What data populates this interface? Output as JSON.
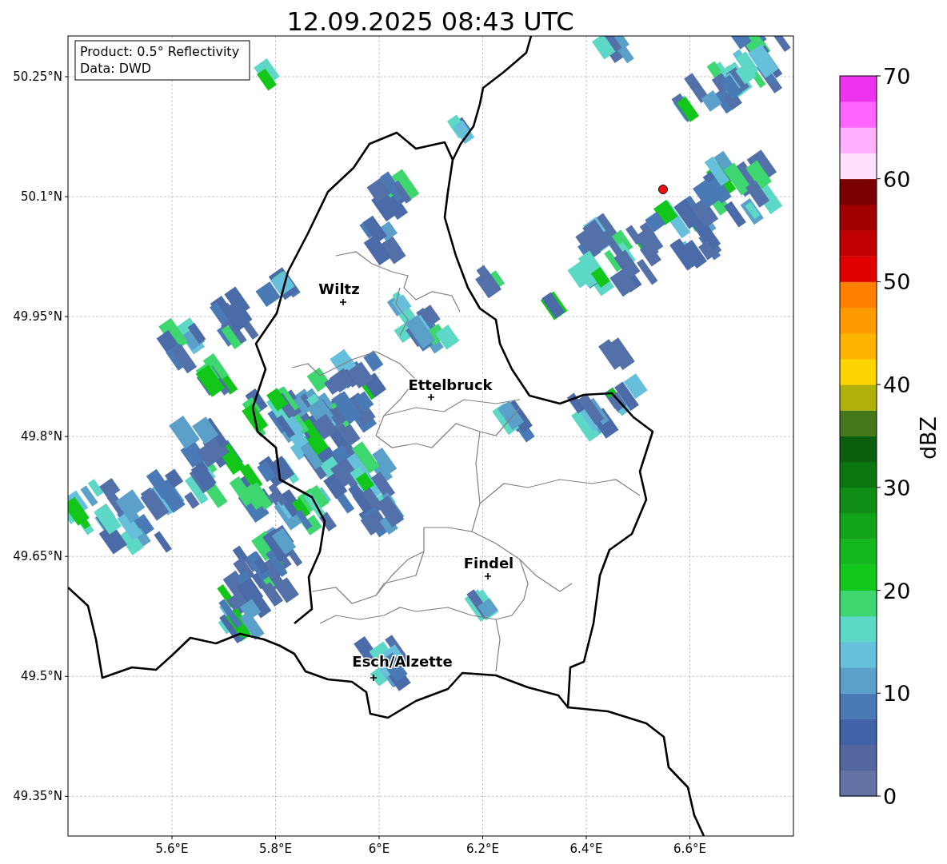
{
  "title": "12.09.2025 08:43 UTC",
  "legend": [
    "Product: 0.5° Reflectivity",
    "Data: DWD"
  ],
  "y_ticks": [
    "50.25°N",
    "50.1°N",
    "49.95°N",
    "49.8°N",
    "49.65°N",
    "49.5°N",
    "49.35°N"
  ],
  "x_ticks": [
    "5.6°E",
    "5.8°E",
    "6°E",
    "6.2°E",
    "6.4°E",
    "6.6°E"
  ],
  "places": [
    {
      "name": "Wiltz"
    },
    {
      "name": "Ettelbruck"
    },
    {
      "name": "Findel"
    },
    {
      "name": "Esch/Alzette"
    }
  ],
  "colorbar": {
    "label": "dBZ",
    "ticks": [
      "70",
      "60",
      "50",
      "40",
      "30",
      "20",
      "10",
      "0"
    ],
    "bins": [
      {
        "color": "#6272a4"
      },
      {
        "color": "#5466a0"
      },
      {
        "color": "#4262a8"
      },
      {
        "color": "#4a7ab5"
      },
      {
        "color": "#5aa0c8"
      },
      {
        "color": "#66c0dc"
      },
      {
        "color": "#5ed8c6"
      },
      {
        "color": "#3ed66e"
      },
      {
        "color": "#12c61a"
      },
      {
        "color": "#14b81c"
      },
      {
        "color": "#11a418"
      },
      {
        "color": "#0f8d14"
      },
      {
        "color": "#0b7510"
      },
      {
        "color": "#0b5e0e"
      },
      {
        "color": "#44761a"
      },
      {
        "color": "#b0b00a"
      },
      {
        "color": "#ffd500"
      },
      {
        "color": "#ffb400"
      },
      {
        "color": "#ff9a00"
      },
      {
        "color": "#ff7f00"
      },
      {
        "color": "#e00000"
      },
      {
        "color": "#c00000"
      },
      {
        "color": "#a00000"
      },
      {
        "color": "#7a0000"
      },
      {
        "color": "#ffe0ff"
      },
      {
        "color": "#ffb0ff"
      },
      {
        "color": "#ff66ff"
      },
      {
        "color": "#ee33ee"
      }
    ]
  }
}
